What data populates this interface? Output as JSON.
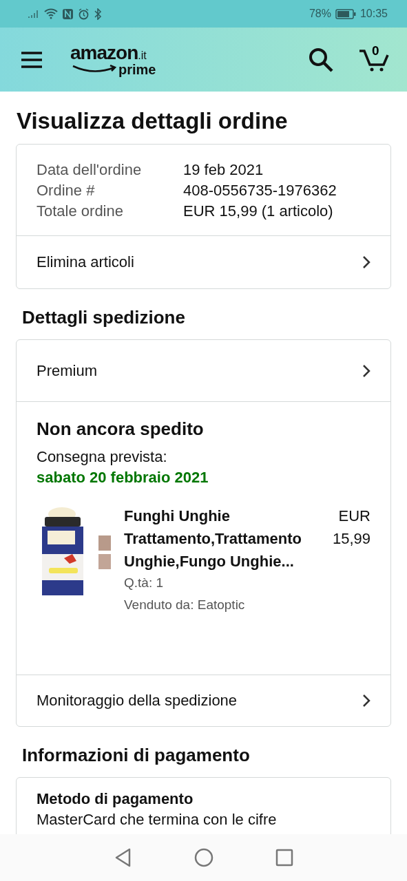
{
  "status_bar": {
    "battery": "78%",
    "time": "10:35"
  },
  "header": {
    "logo": "amazon",
    "logo_suffix": ".it",
    "logo_sub": "prime",
    "cart_count": "0"
  },
  "title": "Visualizza dettagli ordine",
  "order_summary": {
    "rows": [
      {
        "label": "Data dell'ordine",
        "value": "19 feb 2021"
      },
      {
        "label": "Ordine #",
        "value": "408-0556735-1976362"
      },
      {
        "label": "Totale ordine",
        "value": "EUR 15,99 (1 articolo)"
      }
    ],
    "link": "Elimina articoli"
  },
  "shipping": {
    "heading": "Dettagli spedizione",
    "method": "Premium",
    "status": "Non ancora spedito",
    "delivery_label": "Consegna prevista:",
    "delivery_date": "sabato 20 febbraio 2021",
    "item": {
      "kind": "picture",
      "title": "Funghi Unghie Trattamento,Trattamento Unghie,Fungo Unghie...",
      "price": "EUR 15,99",
      "quantity": "Q.tà: 1",
      "seller": "Venduto da: Eatoptic"
    },
    "link": "Monitoraggio della spedizione"
  },
  "payment": {
    "heading": "Informazioni di pagamento",
    "method_label": "Metodo di pagamento",
    "method_value": "MasterCard che termina con le cifre"
  }
}
